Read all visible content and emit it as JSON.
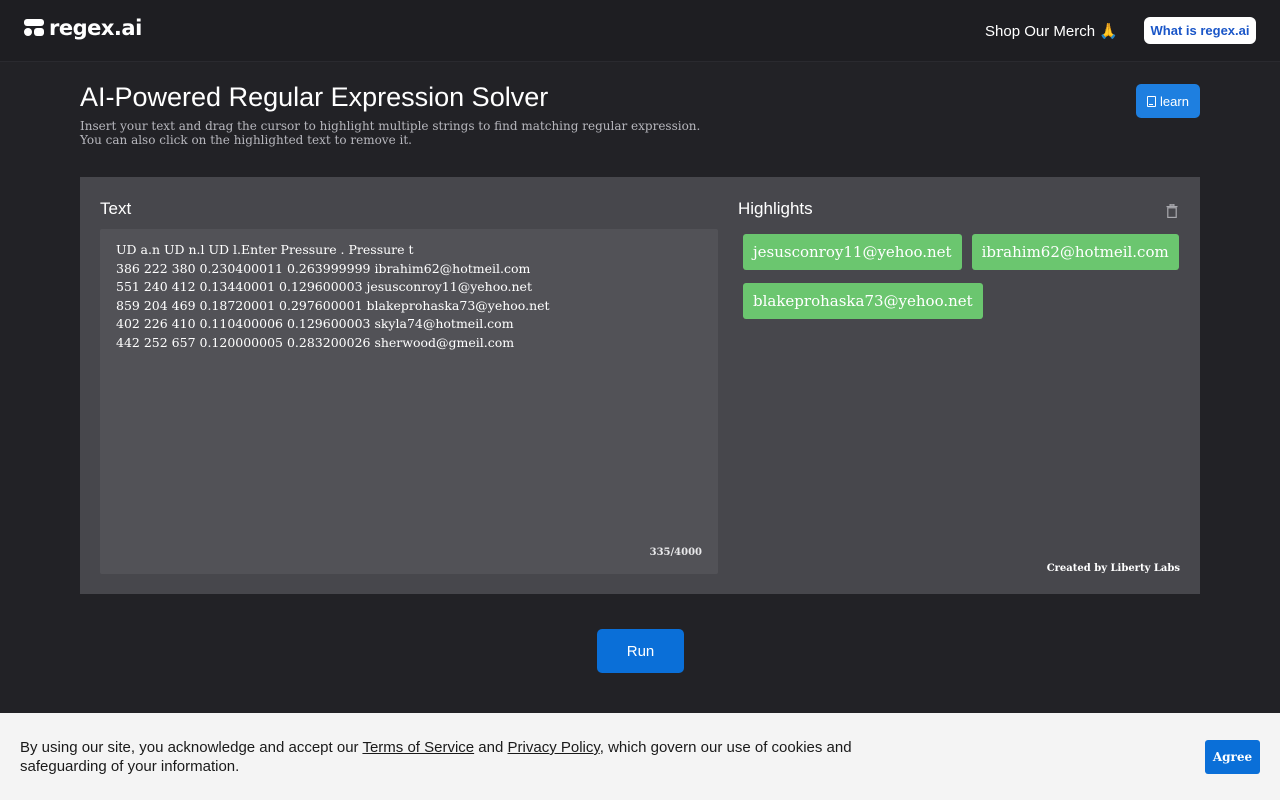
{
  "header": {
    "logo_text": "regex.ai",
    "merch_label": "Shop Our Merch 🙏",
    "what_label": "What is regex.ai"
  },
  "intro": {
    "title": "AI-Powered Regular Expression Solver",
    "subtitle_line1": "Insert your text and drag the cursor to highlight multiple strings to find matching regular expression.",
    "subtitle_line2": "You can also click on the highlighted text to remove it.",
    "learn_label": "learn"
  },
  "text_panel": {
    "heading": "Text",
    "content": "UD a.n UD n.l UD l.Enter Pressure . Pressure t\n386 222 380 0.230400011 0.263999999 ibrahim62@hotmeil.com\n551 240 412 0.13440001 0.129600003 jesusconroy11@yehoo.net\n859 204 469 0.18720001 0.297600001 blakeprohaska73@yehoo.net\n402 226 410 0.110400006 0.129600003 skyla74@hotmeil.com\n442 252 657 0.120000005 0.283200026 sherwood@gmeil.com",
    "char_count": "335/4000"
  },
  "highlights_panel": {
    "heading": "Highlights",
    "chips": [
      "jesusconroy11@yehoo.net",
      "ibrahim62@hotmeil.com",
      "blakeprohaska73@yehoo.net"
    ],
    "credit": "Created by Liberty Labs"
  },
  "actions": {
    "run_label": "Run"
  },
  "cookie": {
    "text_before": "By using our site, you acknowledge and accept our ",
    "terms_link": "Terms of Service",
    "text_middle": " and ",
    "privacy_link": "Privacy Policy",
    "text_after": ", which govern our use of cookies and safeguarding of your information.",
    "agree_label": "Agree"
  },
  "colors": {
    "accent_blue": "#0a6fd8",
    "chip_green": "#6bc66f",
    "panel_bg": "#47474c"
  }
}
